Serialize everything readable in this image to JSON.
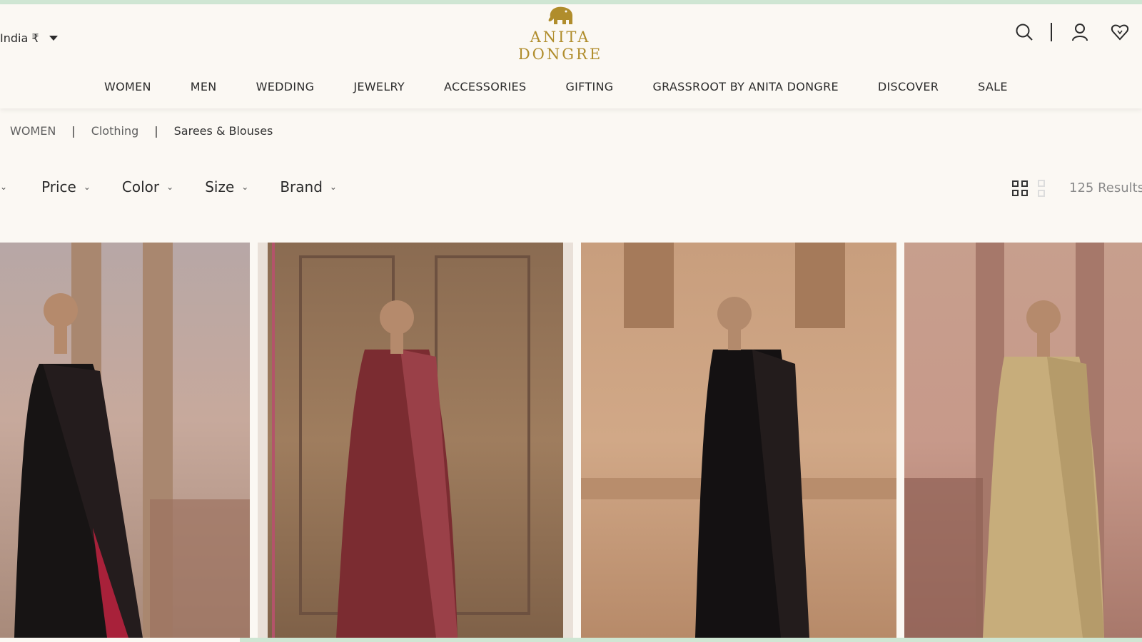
{
  "header": {
    "country_label": "India ₹",
    "brand_name": "ANITA DONGRE",
    "icons": [
      "search-icon",
      "user-icon",
      "wishlist-heart-icon"
    ]
  },
  "nav": {
    "items": [
      "WOMEN",
      "MEN",
      "WEDDING",
      "JEWELRY",
      "ACCESSORIES",
      "GIFTING",
      "GRASSROOT BY ANITA DONGRE",
      "DISCOVER",
      "SALE"
    ]
  },
  "breadcrumb": {
    "items": [
      "WOMEN",
      "Clothing",
      "Sarees & Blouses"
    ],
    "separator": "|"
  },
  "filters": {
    "items": [
      "Price",
      "Color",
      "Size",
      "Brand"
    ]
  },
  "view": {
    "results": "125 Results"
  },
  "products": [
    {
      "color": "black-saree"
    },
    {
      "color": "maroon-printed-saree"
    },
    {
      "color": "black-sheer-saree"
    },
    {
      "color": "gold-printed-saree"
    }
  ],
  "colors": {
    "background": "#fbf8f3",
    "brand_gold": "#b08d2c",
    "accent_strip": "#cfe6d3"
  }
}
